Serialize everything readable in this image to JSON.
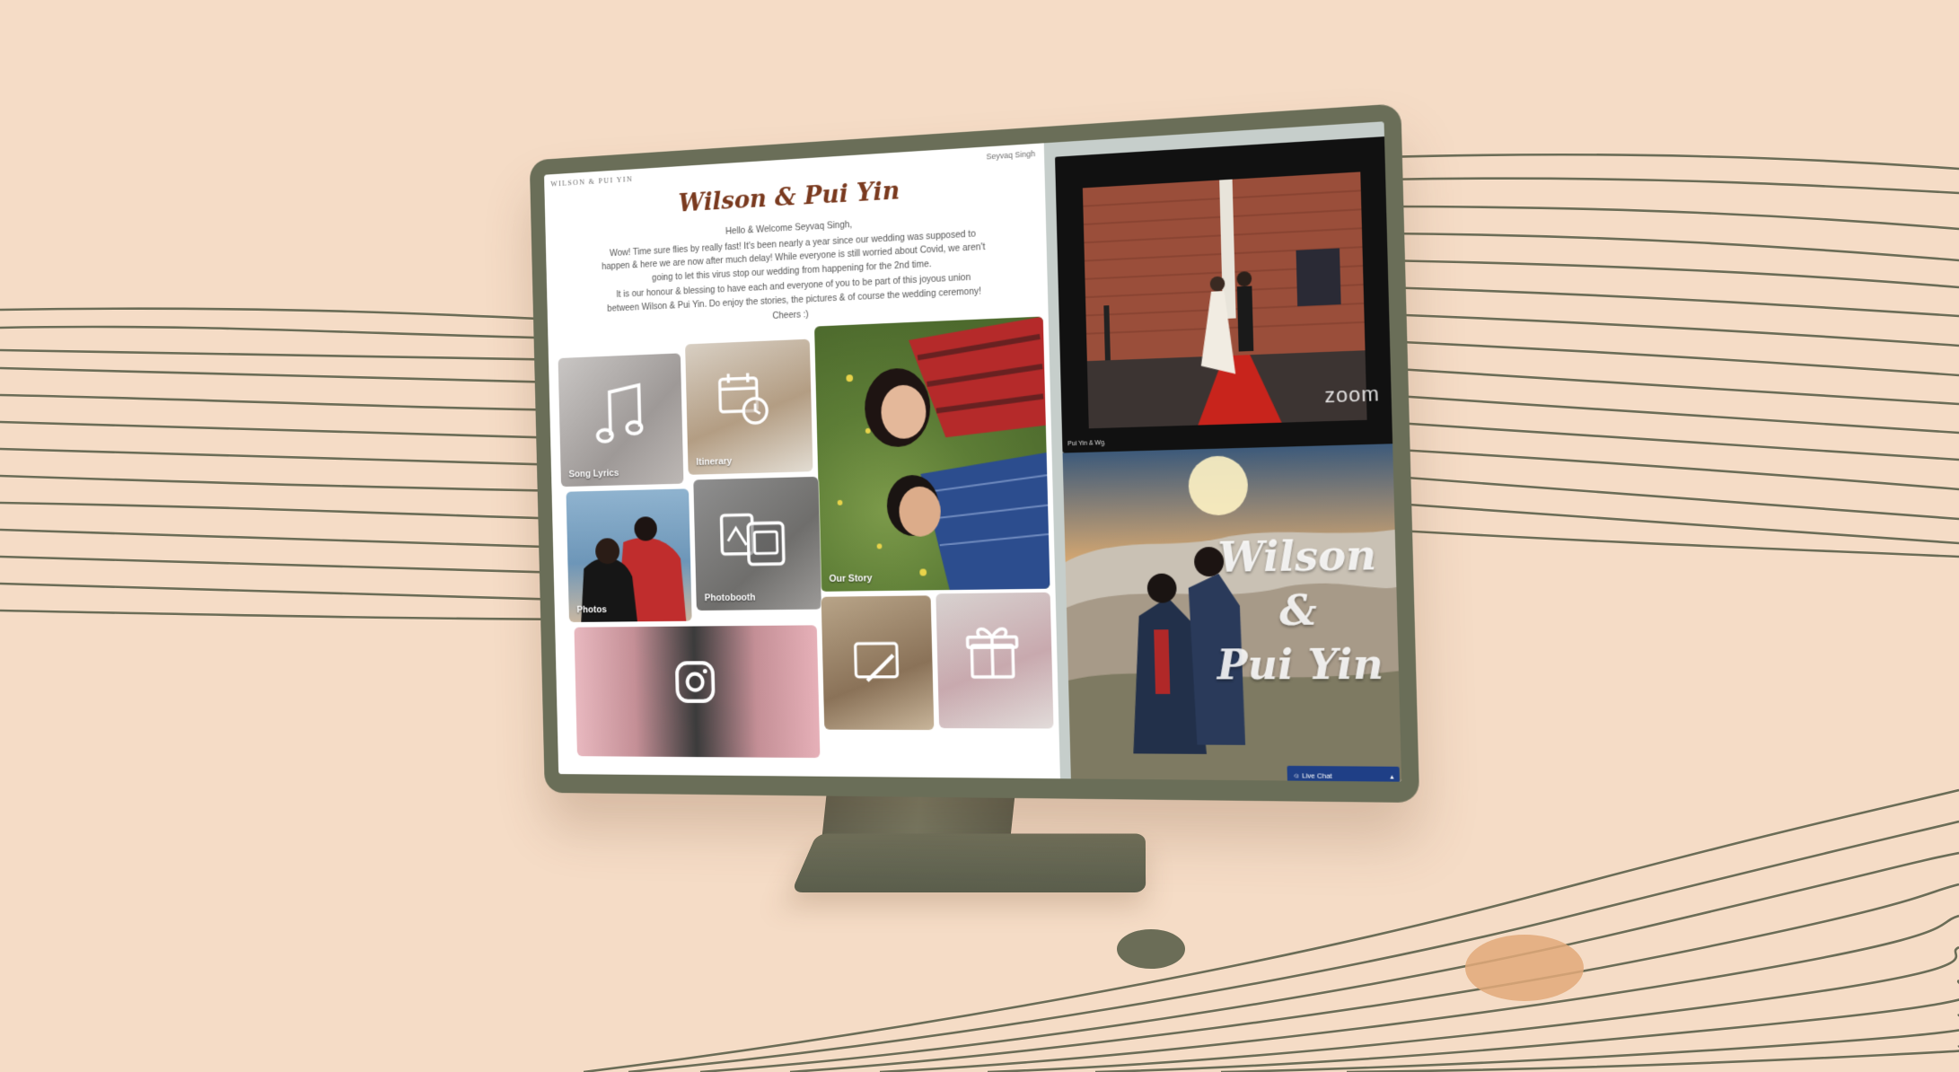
{
  "site": {
    "brand": "WILSON & PUI YIN",
    "user_name": "Seyvaq Singh"
  },
  "welcome": {
    "title": "Wilson & Pui Yin",
    "paragraphs": [
      "Hello & Welcome Seyvaq Singh,",
      "Wow! Time sure flies by really fast! It's been nearly a year since our wedding was supposed to happen & here we are now after much delay! While everyone is still worried about Covid, we aren't going to let this virus stop our wedding from happening for the 2nd time.",
      "It is our honour & blessing to have each and everyone of you to be part of this joyous union between Wilson & Pui Yin. Do enjoy the stories, the pictures & of course the wedding ceremony!",
      "Cheers :)"
    ]
  },
  "tiles": {
    "song_lyrics": "Song Lyrics",
    "itinerary": "Itinerary",
    "our_story": "Our Story",
    "photos": "Photos",
    "photobooth": "Photobooth"
  },
  "zoom": {
    "logo": "zoom",
    "participant": "Pui Yin & Wg"
  },
  "photo": {
    "script_line1": "Wilson &",
    "script_line2": "Pui Yin"
  },
  "live_chat": {
    "label": "☺ Live Chat",
    "toggle": "▴"
  },
  "colors": {
    "background": "#f5dcc6",
    "bezel": "#6a6e58",
    "title_brown": "#7a3a1f",
    "chat_blue": "#1f3f86"
  }
}
